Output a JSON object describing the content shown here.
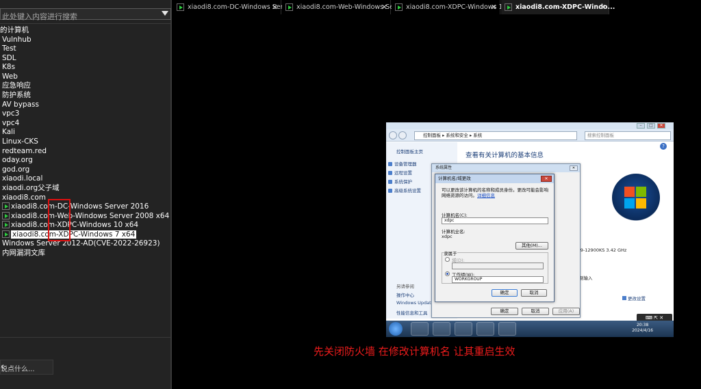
{
  "sidebar": {
    "search_placeholder": "此处键入内容进行搜索",
    "root": "的计算机",
    "groups": [
      "Vulnhub",
      "Test",
      "SDL",
      "K8s",
      "Web",
      "应急响应",
      "防护系统",
      "AV bypass",
      "vpc3",
      "vpc4",
      "Kali",
      "Linux-CKS",
      "redteam.red",
      "oday.org",
      "god.org",
      "xiaodi.local",
      "xiaodi.org父子域",
      "xiaodi8.com"
    ],
    "vms": [
      {
        "label": "xiaodi8.com-DC-Windows Server 2016"
      },
      {
        "label": "xiaodi8.com-Web-Windows Server 2008 x64"
      },
      {
        "label": "xiaodi8.com-XDPC-Windows 10 x64"
      },
      {
        "label": "xiaodi8.com-XDPC-Windows 7 x64"
      }
    ],
    "extra": [
      "Windows Server 2012-AD(CVE-2022-26923)",
      "内网漏洞文库"
    ],
    "comment": "说点什么...",
    "collapse": "‹"
  },
  "tabs": [
    {
      "label": "xiaodi8.com-DC-Windows Ser...",
      "close": "✕"
    },
    {
      "label": "xiaodi8.com-Web-Windows Se...",
      "close": "✕"
    },
    {
      "label": "xiaodi8.com-XDPC-Windows 1...",
      "close": "✕"
    },
    {
      "label": "xiaodi8.com-XDPC-Windo...",
      "close": "✕"
    }
  ],
  "vm": {
    "address": "控制面板 ▸ 系统和安全 ▸ 系统",
    "search": "搜索控制面板",
    "left_pane": {
      "home": "控制面板主页",
      "links": [
        "设备管理器",
        "远程设置",
        "系统保护",
        "高级系统设置"
      ],
      "see_also": "另请参阅",
      "also_links": [
        "操作中心",
        "Windows Update",
        "性能信息和工具"
      ]
    },
    "main_title": "查看有关计算机的基本信息",
    "cpu": "i9-12900KS   3.42 GHz",
    "join": "制输入",
    "change_settings": "更改设置",
    "sysprop": {
      "title": "系统属性",
      "ok": "确定",
      "cancel": "取消",
      "apply": "应用(A)"
    },
    "cname": {
      "title": "计算机名/域更改",
      "desc": "可以更改该计算机的名称和成员身份。更改可能会影响网络资源的访问。",
      "link": "详细信息",
      "name_label": "计算机名(C):",
      "name_value": "xdpc",
      "full_label": "计算机全名:",
      "full_value": "xdpc",
      "more_btn": "其他(M)...",
      "member_of": "隶属于",
      "domain_label": "域(D):",
      "workgroup_label": "工作组(W):",
      "workgroup_value": "WORKGROUP",
      "ok": "确定",
      "cancel": "取消"
    },
    "clock_time": "20:38",
    "clock_date": "2024/4/16",
    "overlay": "⌨ ⇱ ✕"
  },
  "caption": "先关闭防火墙  在修改计算机名 让其重启生效"
}
